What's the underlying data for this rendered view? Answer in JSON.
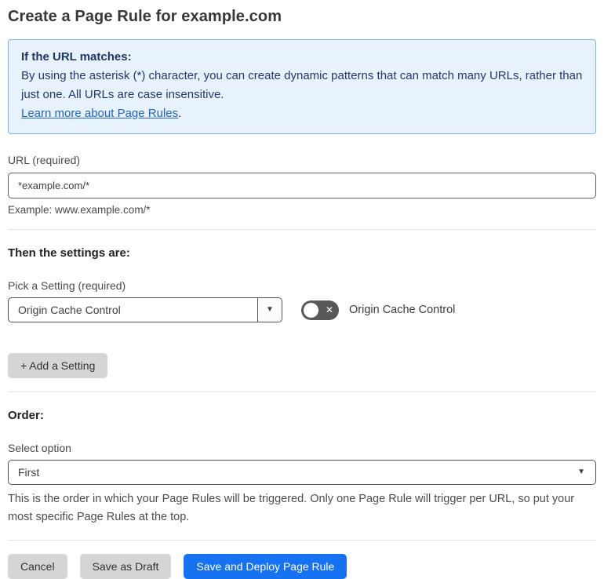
{
  "page": {
    "title": "Create a Page Rule for example.com"
  },
  "info_box": {
    "heading": "If the URL matches:",
    "body": "By using the asterisk (*) character, you can create dynamic patterns that can match many URLs, rather than just one. All URLs are case insensitive.",
    "link": "Learn more about Page Rules",
    "link_suffix": "."
  },
  "url_field": {
    "label": "URL (required)",
    "value": "*example.com/*",
    "example": "Example: www.example.com/*"
  },
  "settings_section": {
    "heading": "Then the settings are:",
    "pick_label": "Pick a Setting (required)",
    "selected_setting": "Origin Cache Control",
    "toggle_label": "Origin Cache Control",
    "toggle_state": "off",
    "add_button": "+ Add a Setting"
  },
  "order_section": {
    "heading": "Order:",
    "select_label": "Select option",
    "selected_option": "First",
    "help": "This is the order in which your Page Rules will be triggered. Only one Page Rule will trigger per URL, so put your most specific Page Rules at the top."
  },
  "footer": {
    "cancel": "Cancel",
    "save_draft": "Save as Draft",
    "save_deploy": "Save and Deploy Page Rule"
  },
  "icons": {
    "caret_down": "▼",
    "toggle_x": "✕"
  },
  "colors": {
    "primary_button": "#1672f1",
    "info_background": "#e8f2fc",
    "info_border": "#7db4e5",
    "info_text": "#22376e",
    "link": "#2063cb",
    "toggle_off": "#585858",
    "gray_button": "#d5d5d5"
  }
}
